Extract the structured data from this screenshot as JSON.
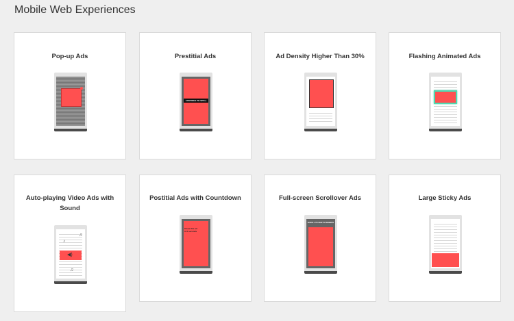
{
  "page": {
    "title": "Mobile Web Experiences"
  },
  "cards": [
    {
      "title": "Pop-up Ads",
      "icon": "popup-ad-phone-icon"
    },
    {
      "title": "Prestitial Ads",
      "icon": "prestitial-ad-phone-icon",
      "overlay_text": "CONTINUE TO SITE ▸"
    },
    {
      "title": "Ad Density Higher Than 30%",
      "icon": "ad-density-phone-icon"
    },
    {
      "title": "Flashing Animated Ads",
      "icon": "flashing-ad-phone-icon"
    },
    {
      "title": "Auto-playing Video Ads with Sound",
      "icon": "autoplay-video-phone-icon"
    },
    {
      "title": "Postitial Ads with Countdown",
      "icon": "postitial-countdown-phone-icon",
      "overlay_text": "Close this ad in 5 seconds"
    },
    {
      "title": "Full-screen Scrollover Ads",
      "icon": "scrollover-ad-phone-icon",
      "overlay_text": "SCROLL TO SKIP TO WEBSITE"
    },
    {
      "title": "Large Sticky Ads",
      "icon": "sticky-ad-phone-icon"
    }
  ],
  "colors": {
    "ad_red": "#ff5050",
    "flash_green": "#4fd9b0",
    "card_bg": "#ffffff",
    "page_bg": "#efefef"
  }
}
